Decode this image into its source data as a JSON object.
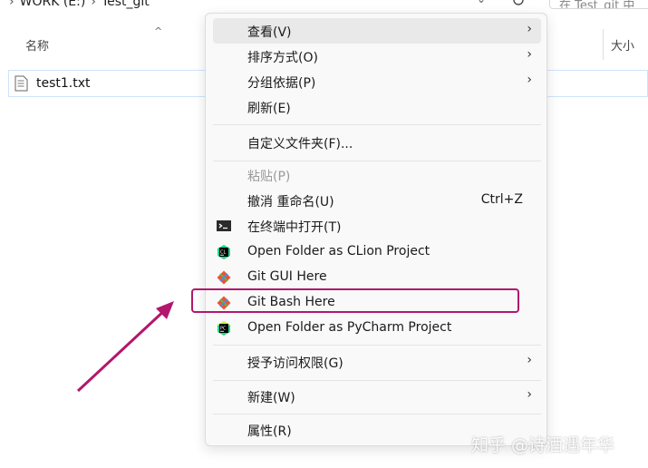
{
  "topbar": {
    "drive": "WORK (E:)",
    "folder": "Test_git",
    "search_placeholder": "在 Test_git 中"
  },
  "columns": {
    "name": "名称",
    "size": "大小"
  },
  "files": [
    {
      "name": "test1.txt"
    }
  ],
  "menu": {
    "view": {
      "label": "查看(V)",
      "arrow": "›"
    },
    "sort": {
      "label": "排序方式(O)",
      "arrow": "›"
    },
    "group": {
      "label": "分组依据(P)",
      "arrow": "›"
    },
    "refresh": {
      "label": "刷新(E)"
    },
    "customize": {
      "label": "自定义文件夹(F)..."
    },
    "paste": {
      "label": "粘贴(P)"
    },
    "undo": {
      "label": "撤消 重命名(U)",
      "shortcut": "Ctrl+Z"
    },
    "terminal": {
      "label": "在终端中打开(T)"
    },
    "clion": {
      "label": "Open Folder as CLion Project"
    },
    "git_gui": {
      "label": "Git GUI Here"
    },
    "git_bash": {
      "label": "Git Bash Here"
    },
    "pycharm": {
      "label": "Open Folder as PyCharm Project"
    },
    "access": {
      "label": "授予访问权限(G)",
      "arrow": "›"
    },
    "new": {
      "label": "新建(W)",
      "arrow": "›"
    },
    "properties": {
      "label": "属性(R)"
    }
  },
  "watermark": "知乎 @诗酒遇年华",
  "colors": {
    "highlight": "#b3166d",
    "git": "#f05133",
    "clion": "#21d789",
    "pycharm": "#21d789"
  }
}
